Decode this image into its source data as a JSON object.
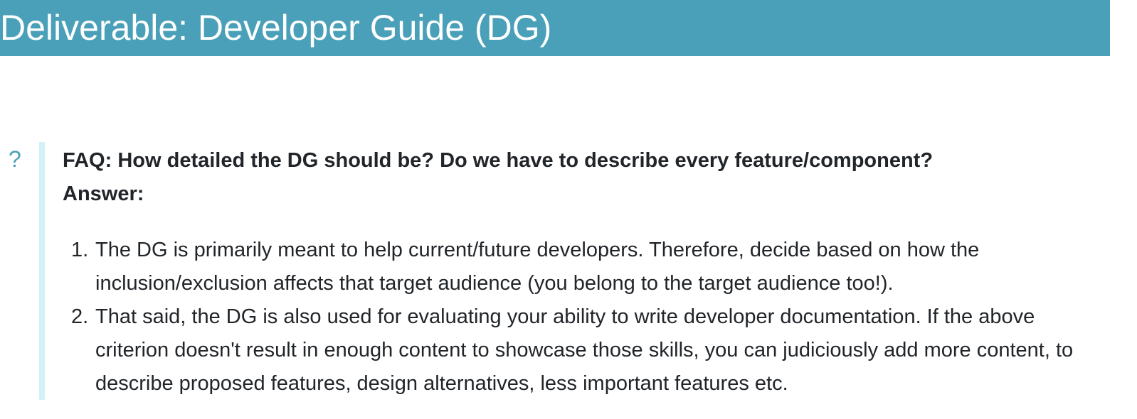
{
  "header": {
    "title": "Deliverable: Developer Guide (DG)"
  },
  "faq": {
    "icon": "question-mark-icon",
    "icon_glyph": "?",
    "question": "FAQ: How detailed the DG should be? Do we have to describe every feature/component?",
    "answer_label": "Answer:",
    "answers": [
      {
        "number": "1.",
        "text": "The DG is primarily meant to help current/future developers. Therefore, decide based on how the inclusion/exclusion affects that target audience (you belong to the target audience too!)."
      },
      {
        "number": "2.",
        "text": "That said, the DG is also used for evaluating your ability to write developer documentation. If the above criterion doesn't result in enough content to showcase those skills, you can judiciously add more content, to describe proposed features, design alternatives, less important features etc."
      }
    ]
  },
  "colors": {
    "header_bg": "#4aa0b8",
    "header_text": "#ffffff",
    "accent": "#4aa0b8",
    "faq_border": "#d4f1f9",
    "body_text": "#212529"
  }
}
